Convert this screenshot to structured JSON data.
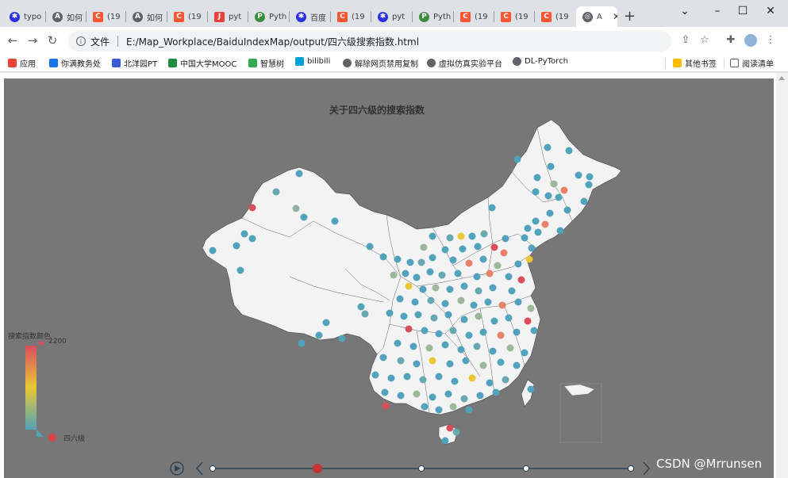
{
  "browser": {
    "tabs": [
      {
        "label": "typo",
        "icon": "baidu-icon"
      },
      {
        "label": "如何",
        "icon": "zhihu-icon"
      },
      {
        "label": "(19",
        "icon": "csdn-icon"
      },
      {
        "label": "如何",
        "icon": "zhihu-icon"
      },
      {
        "label": "(19",
        "icon": "csdn-icon"
      },
      {
        "label": "pyt",
        "icon": "jetbrains-icon"
      },
      {
        "label": "Pyth",
        "icon": "python-icon"
      },
      {
        "label": "百度",
        "icon": "baidu-icon"
      },
      {
        "label": "(19",
        "icon": "csdn-icon"
      },
      {
        "label": "pyt",
        "icon": "baidu-icon"
      },
      {
        "label": "Pyth",
        "icon": "python-icon"
      },
      {
        "label": "(19",
        "icon": "csdn-icon"
      },
      {
        "label": "(19",
        "icon": "csdn-icon"
      },
      {
        "label": "(19",
        "icon": "csdn-icon"
      },
      {
        "label": "A",
        "icon": "globe-icon",
        "active": true
      }
    ],
    "new_tab": "+",
    "window_controls": {
      "chevron": "⌄",
      "minimize": "–",
      "maximize": "☐",
      "close": "✕"
    },
    "url_prefix": "文件",
    "url": "E:/Map_Workplace/BaiduIndexMap/output/四六级搜索指数.html",
    "bookmarks": [
      {
        "label": "应用",
        "color": "#ea4335"
      },
      {
        "label": "你满教务处",
        "color": "#1a73e8"
      },
      {
        "label": "北洋园PT",
        "color": "#3c5bd6"
      },
      {
        "label": "中国大学MOOC",
        "color": "#1e8e3e"
      },
      {
        "label": "智慧树",
        "color": "#34a853"
      },
      {
        "label": "bilibili",
        "color": "#00a1d6"
      },
      {
        "label": "解除网页禁用复制",
        "color": "#5f6368"
      },
      {
        "label": "虚拟仿真实验平台",
        "color": "#5f6368"
      },
      {
        "label": "DL-PyTorch",
        "color": "#5f6368"
      }
    ],
    "other_bookmarks": "其他书签",
    "reading_list": "阅读清单"
  },
  "chart_data": {
    "type": "geo-scatter",
    "title": "关于四六级的搜索指数",
    "visual_map": {
      "label": "搜索指数颜色",
      "max": "2200",
      "min": 0,
      "colors": [
        "#d94e5d",
        "#eac736",
        "#50a3ba"
      ]
    },
    "series": [
      {
        "name": "四六级",
        "color": "#dd4444"
      }
    ],
    "timeline": {
      "points": 5,
      "current_index": 1
    }
  },
  "watermark": "CSDN @Mrrunsen"
}
